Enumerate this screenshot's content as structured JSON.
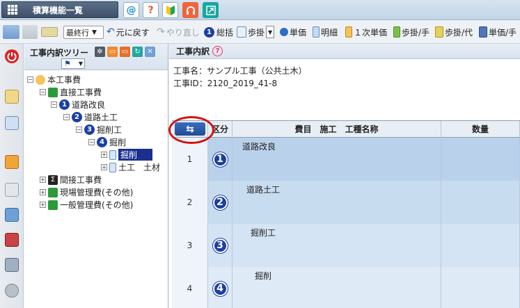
{
  "header": {
    "menu_label": "積算機能一覧",
    "icons": [
      {
        "name": "at-icon",
        "glyph": "@",
        "color": "#1a8fd8"
      },
      {
        "name": "help-icon",
        "glyph": "?",
        "color": "#e8533a"
      },
      {
        "name": "beginner-mark-icon",
        "glyph": "",
        "color": "#19a55a"
      },
      {
        "name": "support-headset-icon",
        "glyph": "",
        "color": "#f0643c"
      },
      {
        "name": "fullscreen-icon",
        "glyph": "",
        "color": "#17a8a0"
      }
    ]
  },
  "toolbar": {
    "select_value": "最終行",
    "undo_label": "元に戻す",
    "redo_label": "やり直し",
    "summary_num": "1",
    "summary_label": "総括",
    "buttons": [
      "歩掛",
      "単価",
      "明細",
      "１次単価",
      "歩掛/手",
      "歩掛/代",
      "単価/手"
    ]
  },
  "tree": {
    "title": "工事内訳ツリー",
    "nodes": [
      {
        "label": "本工事費",
        "num": ""
      },
      {
        "label": "直接工事費",
        "num": ""
      },
      {
        "label": "道路改良",
        "num": "1"
      },
      {
        "label": "道路土工",
        "num": "2"
      },
      {
        "label": "掘削工",
        "num": "3"
      },
      {
        "label": "掘削",
        "num": "4"
      },
      {
        "label": "掘削",
        "num": ""
      },
      {
        "label": "土工　土材",
        "num": ""
      },
      {
        "label": "間接工事費",
        "num": ""
      },
      {
        "label": "現場管理費(その他)",
        "num": ""
      },
      {
        "label": "一般管理費(その他)",
        "num": ""
      }
    ]
  },
  "content": {
    "title": "工事内訳",
    "project_name": "工事名：サンプル工事（公共土木）",
    "project_id": "工事ID：2120_2019_41-8",
    "grid": {
      "swap_glyph": "⇆",
      "col_kubun": "区分",
      "col_name": "費目　施工　工種名称",
      "col_qty": "数量",
      "rows": [
        {
          "no": "1",
          "num": "1",
          "name": "道路改良"
        },
        {
          "no": "2",
          "num": "2",
          "name": "道路土工"
        },
        {
          "no": "3",
          "num": "3",
          "name": "掘削工"
        },
        {
          "no": "4",
          "num": "4",
          "name": "掘削"
        }
      ]
    }
  },
  "colors": {
    "accent": "#1c3fa6",
    "highlight_ring": "#d31212",
    "selection": "#1b2f8f"
  }
}
